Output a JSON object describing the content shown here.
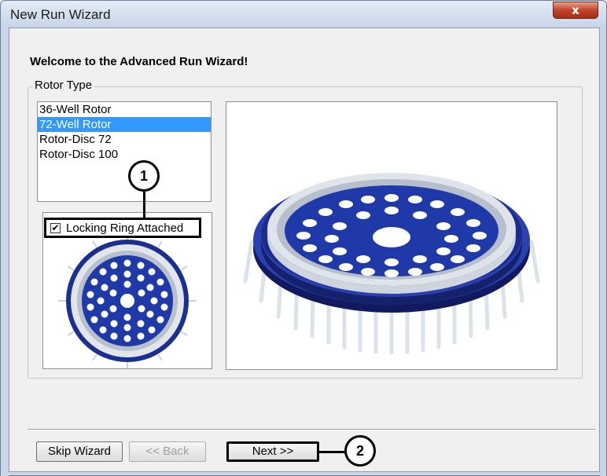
{
  "window": {
    "title": "New Run Wizard",
    "close_symbol": "x"
  },
  "wizard": {
    "welcome": "Welcome to the Advanced Run Wizard!",
    "rotor_group_label": "Rotor Type",
    "rotor_types": [
      {
        "label": "36-Well Rotor",
        "selected": false
      },
      {
        "label": "72-Well Rotor",
        "selected": true
      },
      {
        "label": "Rotor-Disc 72",
        "selected": false
      },
      {
        "label": "Rotor-Disc 100",
        "selected": false
      }
    ],
    "locking_ring": {
      "label": "Locking Ring Attached",
      "checked": true,
      "check_mark": "✔"
    }
  },
  "buttons": {
    "skip": "Skip Wizard",
    "back": "<< Back",
    "next": "Next >>"
  },
  "callouts": [
    "1",
    "2"
  ],
  "colors": {
    "rotor_blue": "#1f3aa8",
    "selection": "#3399ff",
    "close_red": "#c0442a"
  }
}
